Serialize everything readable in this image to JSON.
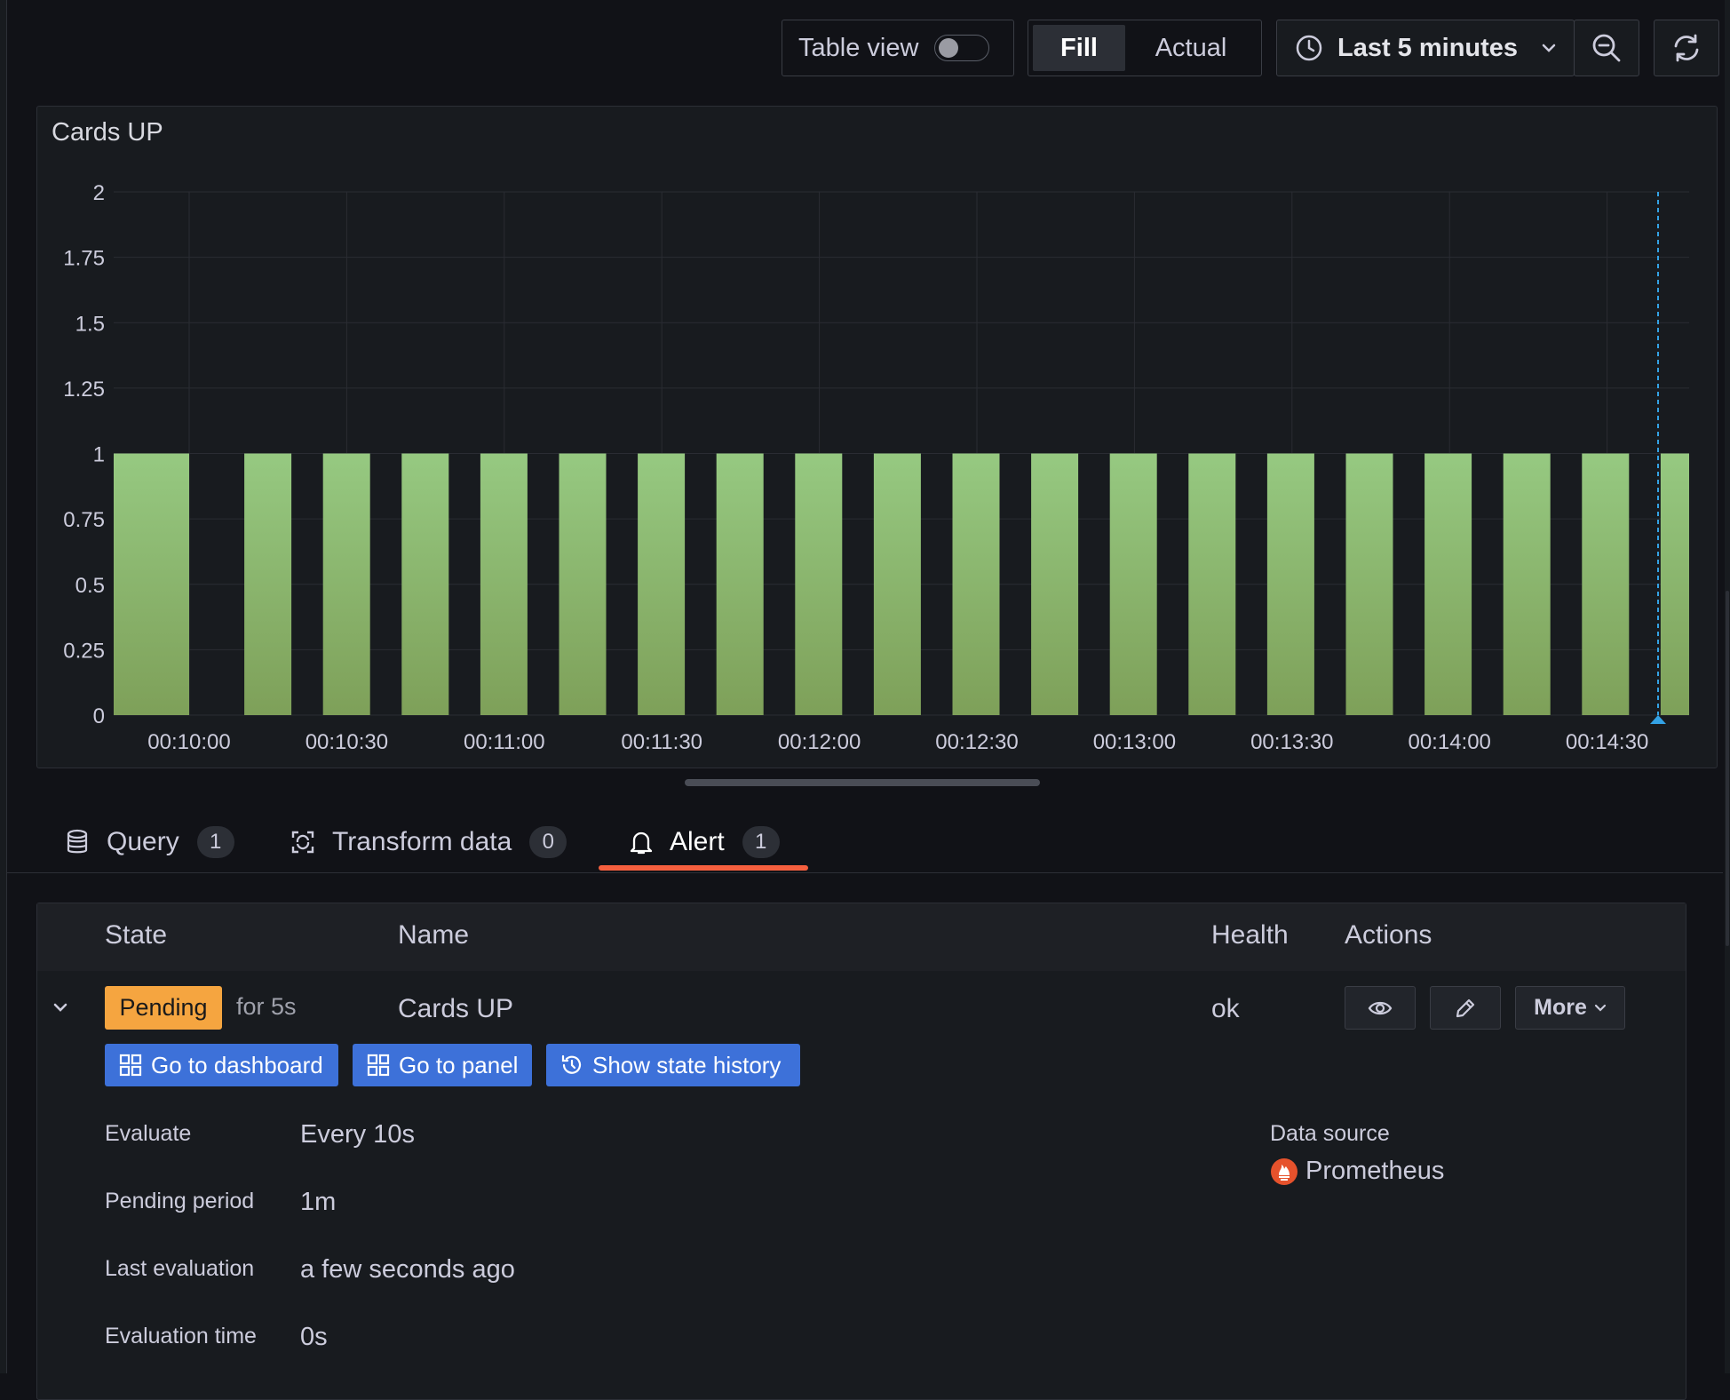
{
  "toolbar": {
    "table_view_label": "Table view",
    "table_view_on": false,
    "fill_label": "Fill",
    "actual_label": "Actual",
    "time_range_label": "Last 5 minutes"
  },
  "panel": {
    "title": "Cards UP"
  },
  "chart_data": {
    "type": "bar",
    "title": "Cards UP",
    "y_ticks": [
      "2",
      "1.75",
      "1.5",
      "1.25",
      "1",
      "0.75",
      "0.5",
      "0.25",
      "0"
    ],
    "x_ticks": [
      "00:10:00",
      "00:10:30",
      "00:11:00",
      "00:11:30",
      "00:12:00",
      "00:12:30",
      "00:13:00",
      "00:13:30",
      "00:14:00",
      "00:14:30"
    ],
    "ylim": [
      0,
      2
    ],
    "series": [
      {
        "values": [
          1,
          1,
          1,
          1,
          1,
          1,
          1,
          1,
          1,
          1,
          1,
          1,
          1,
          1,
          1,
          1,
          1,
          1,
          1,
          1,
          1
        ]
      }
    ],
    "grid": true,
    "bar_color_top": "#96c981",
    "bar_color_bottom": "#7ea059",
    "cursor_color": "#33a2e5"
  },
  "tabs": [
    {
      "label": "Query",
      "count": "1"
    },
    {
      "label": "Transform data",
      "count": "0"
    },
    {
      "label": "Alert",
      "count": "1"
    }
  ],
  "alert_table": {
    "headers": {
      "state": "State",
      "name": "Name",
      "health": "Health",
      "actions": "Actions"
    },
    "row": {
      "state": "Pending",
      "state_duration": "for 5s",
      "name": "Cards UP",
      "health": "ok",
      "more_label": "More"
    },
    "buttons": {
      "go_to_dashboard": "Go to dashboard",
      "go_to_panel": "Go to panel",
      "show_state_history": "Show state history"
    },
    "details": {
      "evaluate_label": "Evaluate",
      "evaluate_value": "Every 10s",
      "pending_period_label": "Pending period",
      "pending_period_value": "1m",
      "last_evaluation_label": "Last evaluation",
      "last_evaluation_value": "a few seconds ago",
      "evaluation_time_label": "Evaluation time",
      "evaluation_time_value": "0s",
      "data_source_label": "Data source",
      "data_source_value": "Prometheus"
    }
  },
  "colors": {
    "background": "#111217",
    "panel": "#181b1f",
    "pending_badge": "#f5a540",
    "primary_button": "#3d71d9",
    "active_tab_underline": "#f55f3e",
    "prometheus": "#e6522c"
  }
}
